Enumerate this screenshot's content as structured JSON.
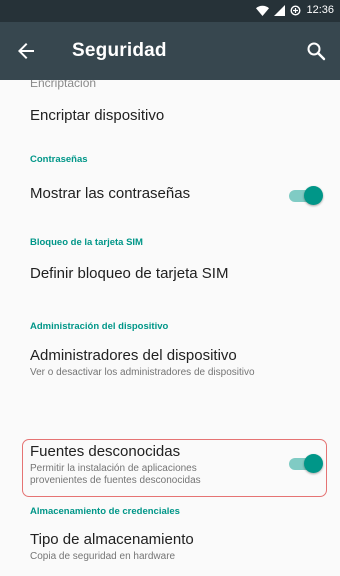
{
  "status_bar": {
    "time": "12:36",
    "icons": [
      "wifi-icon",
      "signal-icon",
      "data-saver-icon"
    ]
  },
  "app_bar": {
    "title": "Seguridad",
    "back_icon": "arrow-back-icon",
    "search_icon": "search-icon"
  },
  "settings": {
    "partial_section_top": "Encriptación",
    "encrypt": {
      "title": "Encriptar dispositivo"
    },
    "passwords_section": "Contraseñas",
    "show_passwords": {
      "title": "Mostrar las contraseñas",
      "enabled": true
    },
    "sim_section": "Bloqueo de la tarjeta SIM",
    "sim_lock": {
      "title": "Definir bloqueo de tarjeta SIM"
    },
    "admin_section": "Administración del dispositivo",
    "device_admins": {
      "title": "Administradores del dispositivo",
      "subtitle": "Ver o desactivar los administradores de dispositivo"
    },
    "unknown_sources": {
      "title": "Fuentes desconocidas",
      "subtitle_line1": "Permitir la instalación de aplicaciones",
      "subtitle_line2": "provenientes de fuentes desconocidas",
      "enabled": true
    },
    "credentials_section": "Almacenamiento de credenciales",
    "storage_type": {
      "title": "Tipo de almacenamiento",
      "subtitle": "Copia de seguridad en hardware"
    }
  },
  "colors": {
    "accent": "#009688",
    "toolbar": "#37474f",
    "status_bar": "#263238",
    "highlight": "#e57373"
  }
}
